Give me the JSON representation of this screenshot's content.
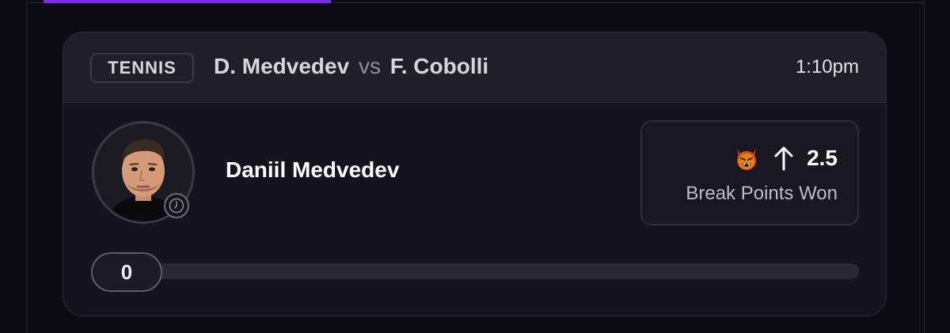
{
  "card": {
    "sport": "TENNIS",
    "player_one": "D. Medvedev",
    "vs_label": "vs",
    "player_two": "F. Cobolli",
    "time": "1:10pm"
  },
  "player": {
    "full_name": "Daniil Medvedev",
    "avatar_icon": "player-headshot",
    "status_icon": "clock-icon"
  },
  "prop": {
    "icon": "demon-icon",
    "direction_icon": "arrow-up-icon",
    "line": "2.5",
    "stat": "Break Points Won"
  },
  "progress": {
    "current": "0",
    "fraction": 0
  },
  "colors": {
    "accent": "#7a2ee6",
    "background": "#0d0c15",
    "card": "#15141e"
  }
}
